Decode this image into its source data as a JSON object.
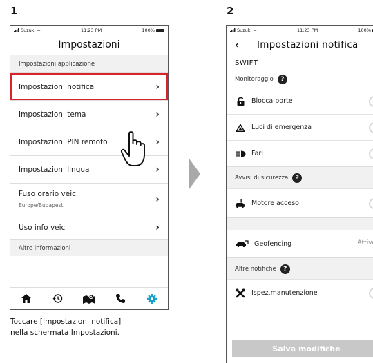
{
  "steps": {
    "step1": "1",
    "step2": "2"
  },
  "status": {
    "carrier": "Suzuki",
    "time": "11:23 PM",
    "battery": "100%"
  },
  "screen1": {
    "title": "Impostazioni",
    "section_app": "Impostazioni applicazione",
    "items": [
      {
        "label": "Impostazioni notifica"
      },
      {
        "label": "Impostazioni tema"
      },
      {
        "label": "Impostazioni PIN remoto"
      },
      {
        "label": "Impostazioni lingua"
      },
      {
        "label": "Fuso orario veic.",
        "sub": "Europe/Budapest"
      },
      {
        "label": "Uso info veic"
      }
    ],
    "section_other": "Altre informazioni",
    "tabs": [
      "home-icon",
      "history-icon",
      "map-icon",
      "phone-icon",
      "gear-icon"
    ],
    "highlight_color": "#d8232a",
    "accent_color": "#1aa3c8"
  },
  "caption": {
    "line1": "Toccare [Impostazioni notifica]",
    "line2": "nella schermata Impostazioni."
  },
  "screen2": {
    "title": "Impostazioni notifica",
    "vehicle": "SWIFT",
    "monitoring": "Monitoraggio",
    "rows_monitor": [
      {
        "label": "Blocca porte",
        "icon": "lock-icon"
      },
      {
        "label": "Luci di emergenza",
        "icon": "hazard-icon"
      },
      {
        "label": "Fari",
        "icon": "headlight-icon"
      }
    ],
    "safety": "Avvisi di sicurezza",
    "engine": "Motore acceso",
    "geofencing": "Geofencing",
    "geofencing_status": "Attivo",
    "other": "Altre notifiche",
    "maintenance": "Ispez.manutenzione",
    "save": "Salva modifiche"
  }
}
